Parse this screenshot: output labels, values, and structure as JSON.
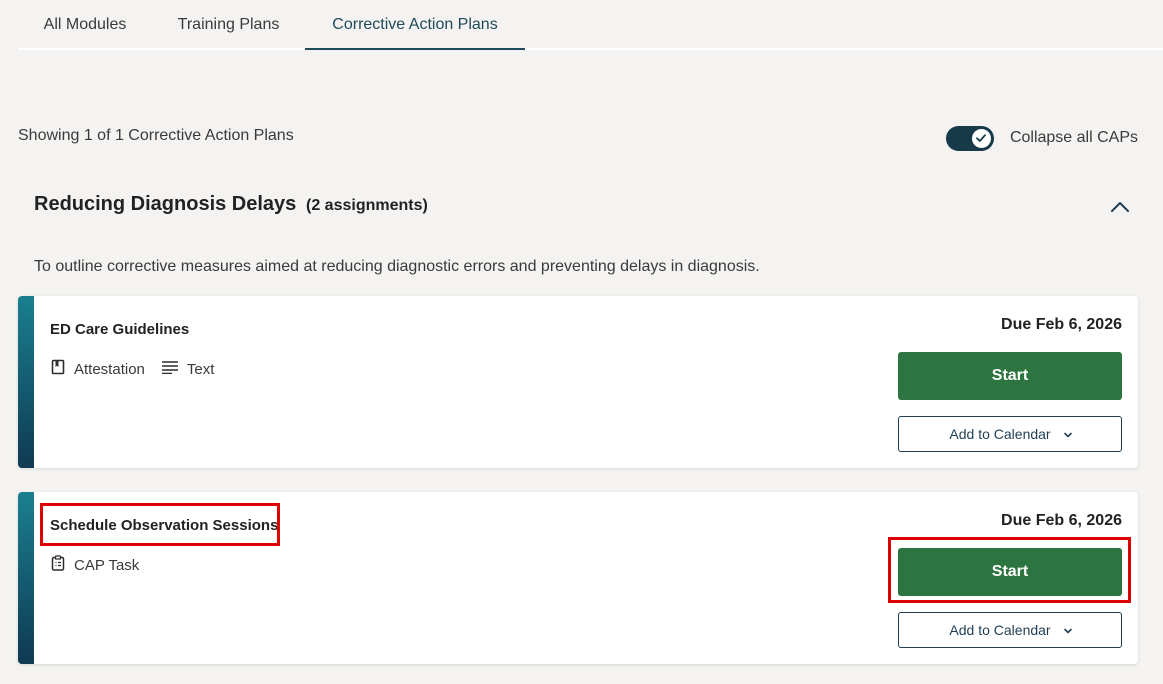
{
  "tabs": [
    {
      "label": "All Modules"
    },
    {
      "label": "Training Plans"
    },
    {
      "label": "Corrective Action Plans",
      "active": true
    }
  ],
  "summary": {
    "showing_text": "Showing 1 of 1 Corrective Action Plans",
    "collapse_label": "Collapse all CAPs",
    "collapse_enabled": true
  },
  "group": {
    "title": "Reducing Diagnosis Delays",
    "count": "(2 assignments)",
    "description": "To outline corrective measures aimed at reducing diagnostic errors and preventing delays in diagnosis."
  },
  "assignments": [
    {
      "title": "ED Care Guidelines",
      "types": [
        {
          "icon": "attestation-icon",
          "label": "Attestation"
        },
        {
          "icon": "text-lines-icon",
          "label": "Text"
        }
      ],
      "due": "Due Feb 6, 2026",
      "start_label": "Start",
      "calendar_label": "Add to Calendar"
    },
    {
      "title": "Schedule Observation Sessions",
      "types": [
        {
          "icon": "clipboard-icon",
          "label": "CAP Task"
        }
      ],
      "due": "Due Feb 6, 2026",
      "start_label": "Start",
      "calendar_label": "Add to Calendar"
    }
  ],
  "colors": {
    "accent_dark": "#173a4a",
    "start_green": "#2c7540",
    "highlight_red": "#e00000"
  }
}
